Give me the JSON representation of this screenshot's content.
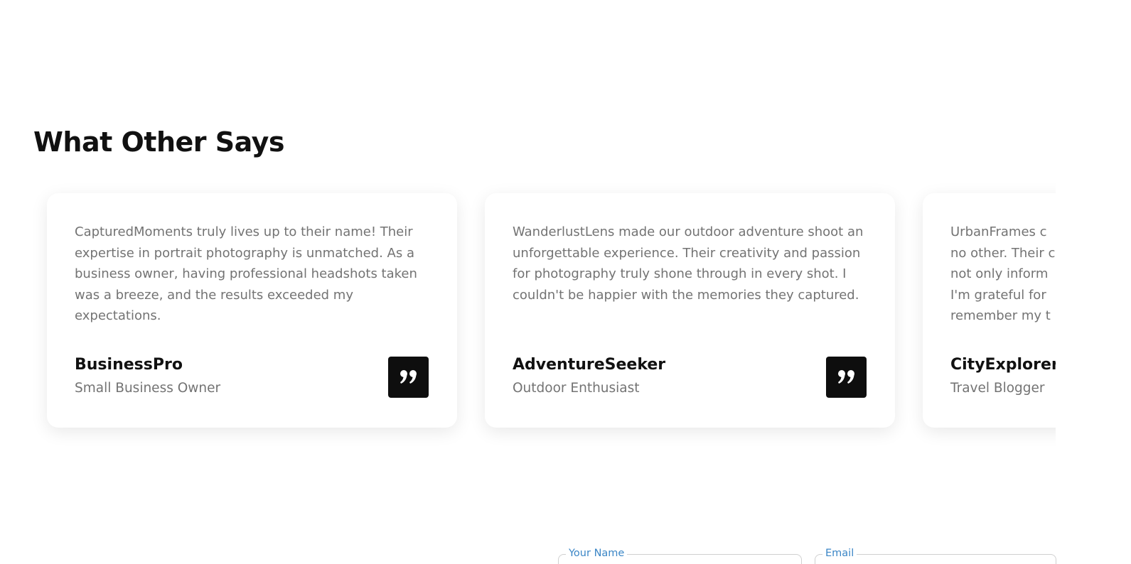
{
  "section": {
    "title": "What Other Says"
  },
  "testimonials": [
    {
      "text": "CapturedMoments truly lives up to their name! Their expertise in portrait photography is unmatched. As a business owner, having professional headshots taken was a breeze, and the results exceeded my expectations.",
      "name": "BusinessPro",
      "role": "Small Business Owner",
      "icon": "quote-icon"
    },
    {
      "text": "WanderlustLens made our outdoor adventure shoot an unforgettable experience. Their creativity and passion for photography truly shone through in every shot. I couldn't be happier with the memories they captured.",
      "name": "AdventureSeeker",
      "role": "Outdoor Enthusiast",
      "icon": "quote-icon"
    },
    {
      "text": "UrbanFrames c\nno other. Their c\nnot only inform\nI'm grateful for\nremember my t",
      "name": "CityExplorer",
      "role": "Travel Blogger",
      "icon": "quote-icon"
    }
  ],
  "form": {
    "name_label": "Your Name",
    "email_label": "Email"
  },
  "colors": {
    "title": "#111111",
    "body_text": "#737373",
    "badge": "#0e0e0e",
    "field_label": "#3b86c6"
  }
}
